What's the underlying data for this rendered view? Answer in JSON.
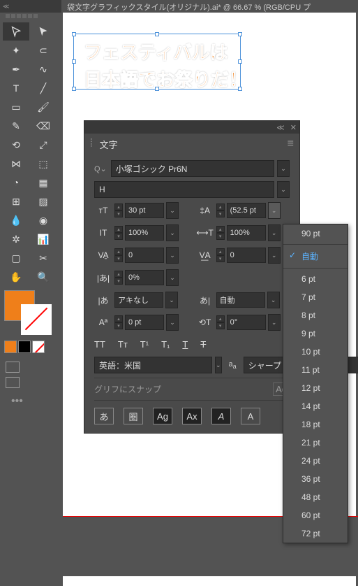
{
  "titlebar": "袋文字グラフィックスタイル(オリジナル).ai* @ 66.67 % (RGB/CPU プ",
  "canvas_text1": "フェスティバルは",
  "canvas_text2": "日本語でお祭りだ！",
  "panel": {
    "tab": "文字",
    "font_family": "小塚ゴシック Pr6N",
    "font_style": "H",
    "font_size": "30 pt",
    "leading": "(52.5 pt",
    "v_scale": "100%",
    "h_scale": "100%",
    "va": "0",
    "tracking": "0",
    "tsume": "0%",
    "aki": "アキなし",
    "aki_auto": "自動",
    "baseline": "0 pt",
    "rotation": "0°",
    "lang": "英語：米国",
    "aa": "シャープ",
    "snap": "グリフにスナップ",
    "tt1": "TT",
    "tt2": "Tт",
    "tt3": "T¹",
    "tt4": "T₁",
    "tt5": "T",
    "tt6": "Ŧ",
    "aa1": "あ",
    "aa2": "圈",
    "aa3": "Ag",
    "aa4": "Ax",
    "aa5": "A",
    "aa6": "A"
  },
  "dropdown": {
    "items": [
      "90 pt",
      "自動",
      "6 pt",
      "7 pt",
      "8 pt",
      "9 pt",
      "10 pt",
      "11 pt",
      "12 pt",
      "14 pt",
      "18 pt",
      "21 pt",
      "24 pt",
      "36 pt",
      "48 pt",
      "60 pt",
      "72 pt"
    ],
    "selected": "自動"
  }
}
